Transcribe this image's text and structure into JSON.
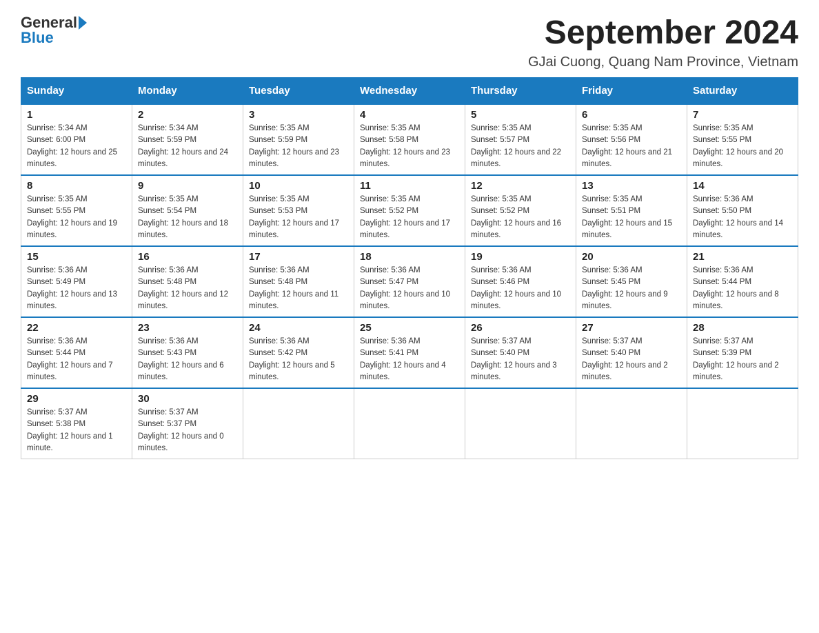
{
  "logo": {
    "general": "General",
    "blue": "Blue"
  },
  "title": "September 2024",
  "subtitle": "GJai Cuong, Quang Nam Province, Vietnam",
  "days_of_week": [
    "Sunday",
    "Monday",
    "Tuesday",
    "Wednesday",
    "Thursday",
    "Friday",
    "Saturday"
  ],
  "weeks": [
    [
      {
        "day": "1",
        "sunrise": "5:34 AM",
        "sunset": "6:00 PM",
        "daylight": "12 hours and 25 minutes."
      },
      {
        "day": "2",
        "sunrise": "5:34 AM",
        "sunset": "5:59 PM",
        "daylight": "12 hours and 24 minutes."
      },
      {
        "day": "3",
        "sunrise": "5:35 AM",
        "sunset": "5:59 PM",
        "daylight": "12 hours and 23 minutes."
      },
      {
        "day": "4",
        "sunrise": "5:35 AM",
        "sunset": "5:58 PM",
        "daylight": "12 hours and 23 minutes."
      },
      {
        "day": "5",
        "sunrise": "5:35 AM",
        "sunset": "5:57 PM",
        "daylight": "12 hours and 22 minutes."
      },
      {
        "day": "6",
        "sunrise": "5:35 AM",
        "sunset": "5:56 PM",
        "daylight": "12 hours and 21 minutes."
      },
      {
        "day": "7",
        "sunrise": "5:35 AM",
        "sunset": "5:55 PM",
        "daylight": "12 hours and 20 minutes."
      }
    ],
    [
      {
        "day": "8",
        "sunrise": "5:35 AM",
        "sunset": "5:55 PM",
        "daylight": "12 hours and 19 minutes."
      },
      {
        "day": "9",
        "sunrise": "5:35 AM",
        "sunset": "5:54 PM",
        "daylight": "12 hours and 18 minutes."
      },
      {
        "day": "10",
        "sunrise": "5:35 AM",
        "sunset": "5:53 PM",
        "daylight": "12 hours and 17 minutes."
      },
      {
        "day": "11",
        "sunrise": "5:35 AM",
        "sunset": "5:52 PM",
        "daylight": "12 hours and 17 minutes."
      },
      {
        "day": "12",
        "sunrise": "5:35 AM",
        "sunset": "5:52 PM",
        "daylight": "12 hours and 16 minutes."
      },
      {
        "day": "13",
        "sunrise": "5:35 AM",
        "sunset": "5:51 PM",
        "daylight": "12 hours and 15 minutes."
      },
      {
        "day": "14",
        "sunrise": "5:36 AM",
        "sunset": "5:50 PM",
        "daylight": "12 hours and 14 minutes."
      }
    ],
    [
      {
        "day": "15",
        "sunrise": "5:36 AM",
        "sunset": "5:49 PM",
        "daylight": "12 hours and 13 minutes."
      },
      {
        "day": "16",
        "sunrise": "5:36 AM",
        "sunset": "5:48 PM",
        "daylight": "12 hours and 12 minutes."
      },
      {
        "day": "17",
        "sunrise": "5:36 AM",
        "sunset": "5:48 PM",
        "daylight": "12 hours and 11 minutes."
      },
      {
        "day": "18",
        "sunrise": "5:36 AM",
        "sunset": "5:47 PM",
        "daylight": "12 hours and 10 minutes."
      },
      {
        "day": "19",
        "sunrise": "5:36 AM",
        "sunset": "5:46 PM",
        "daylight": "12 hours and 10 minutes."
      },
      {
        "day": "20",
        "sunrise": "5:36 AM",
        "sunset": "5:45 PM",
        "daylight": "12 hours and 9 minutes."
      },
      {
        "day": "21",
        "sunrise": "5:36 AM",
        "sunset": "5:44 PM",
        "daylight": "12 hours and 8 minutes."
      }
    ],
    [
      {
        "day": "22",
        "sunrise": "5:36 AM",
        "sunset": "5:44 PM",
        "daylight": "12 hours and 7 minutes."
      },
      {
        "day": "23",
        "sunrise": "5:36 AM",
        "sunset": "5:43 PM",
        "daylight": "12 hours and 6 minutes."
      },
      {
        "day": "24",
        "sunrise": "5:36 AM",
        "sunset": "5:42 PM",
        "daylight": "12 hours and 5 minutes."
      },
      {
        "day": "25",
        "sunrise": "5:36 AM",
        "sunset": "5:41 PM",
        "daylight": "12 hours and 4 minutes."
      },
      {
        "day": "26",
        "sunrise": "5:37 AM",
        "sunset": "5:40 PM",
        "daylight": "12 hours and 3 minutes."
      },
      {
        "day": "27",
        "sunrise": "5:37 AM",
        "sunset": "5:40 PM",
        "daylight": "12 hours and 2 minutes."
      },
      {
        "day": "28",
        "sunrise": "5:37 AM",
        "sunset": "5:39 PM",
        "daylight": "12 hours and 2 minutes."
      }
    ],
    [
      {
        "day": "29",
        "sunrise": "5:37 AM",
        "sunset": "5:38 PM",
        "daylight": "12 hours and 1 minute."
      },
      {
        "day": "30",
        "sunrise": "5:37 AM",
        "sunset": "5:37 PM",
        "daylight": "12 hours and 0 minutes."
      },
      null,
      null,
      null,
      null,
      null
    ]
  ],
  "labels": {
    "sunrise": "Sunrise:",
    "sunset": "Sunset:",
    "daylight": "Daylight:"
  }
}
